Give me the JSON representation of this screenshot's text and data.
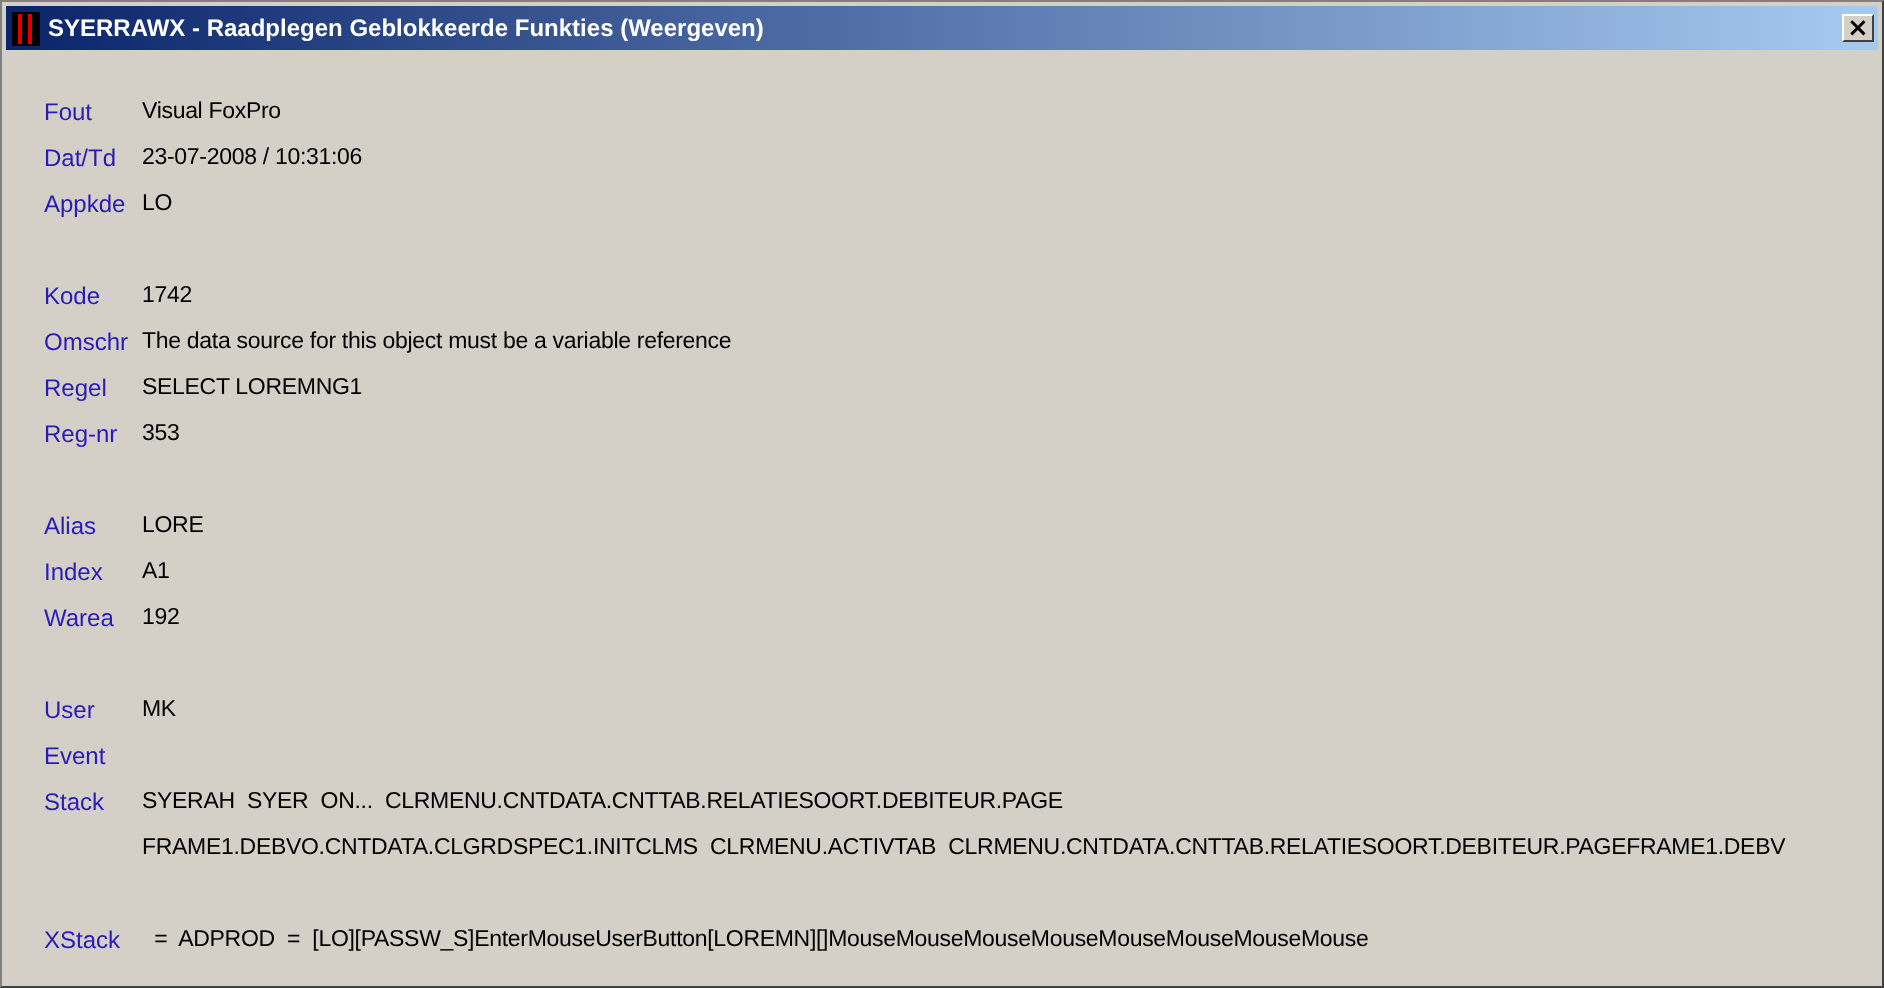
{
  "window": {
    "title": "SYERRAWX - Raadplegen Geblokkeerde Funkties (Weergeven)",
    "close": "×"
  },
  "groups": [
    {
      "fields": [
        {
          "label": "Fout",
          "lines": [
            "Visual FoxPro"
          ]
        },
        {
          "label": "Dat/Td",
          "lines": [
            "23-07-2008 / 10:31:06"
          ]
        },
        {
          "label": "Appkde",
          "lines": [
            "LO"
          ]
        }
      ]
    },
    {
      "fields": [
        {
          "label": "Kode",
          "lines": [
            "1742"
          ]
        },
        {
          "label": "Omschr",
          "lines": [
            "The data source for this object must be a variable reference"
          ]
        },
        {
          "label": "Regel",
          "lines": [
            "SELECT LOREMNG1"
          ]
        },
        {
          "label": "Reg-nr",
          "lines": [
            "353"
          ]
        }
      ]
    },
    {
      "fields": [
        {
          "label": "Alias",
          "lines": [
            "LORE"
          ]
        },
        {
          "label": "Index",
          "lines": [
            "A1"
          ]
        },
        {
          "label": "Warea",
          "lines": [
            "192"
          ]
        }
      ]
    },
    {
      "fields": [
        {
          "label": "User",
          "lines": [
            "MK"
          ]
        },
        {
          "label": "Event"
        },
        {
          "label": "Stack",
          "lines": [
            "SYERAH  SYER  ON...  CLRMENU.CNTDATA.CNTTAB.RELATIESOORT.DEBITEUR.PAGE",
            "FRAME1.DEBVO.CNTDATA.CLGRDSPEC1.INITCLMS  CLRMENU.ACTIVTAB  CLRMENU.CNTDATA.CNTTAB.RELATIESOORT.DEBITEUR.PAGEFRAME1.DEBV"
          ]
        }
      ]
    },
    {
      "fields": [
        {
          "label": "XStack",
          "lines": [
            "  =  ADPROD  =  [LO][PASSW_S]EnterMouseUserButton[LOREMN][]MouseMouseMouseMouseMouseMouseMouseMouse"
          ]
        }
      ]
    }
  ]
}
